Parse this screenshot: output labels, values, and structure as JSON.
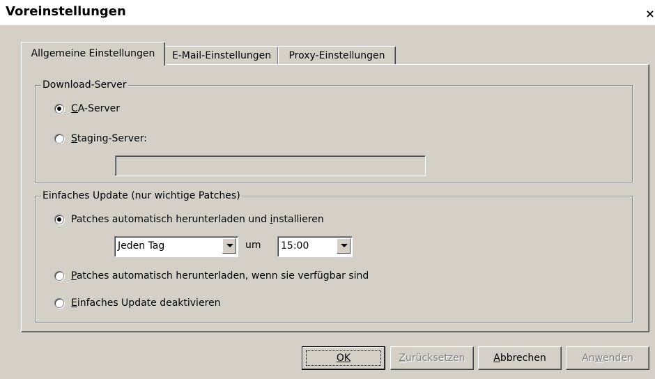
{
  "window": {
    "title": "Voreinstellungen",
    "close_label": "×"
  },
  "tabs": [
    {
      "label": "Allgemeine Einstellungen",
      "active": true
    },
    {
      "label": "E-Mail-Einstellungen",
      "active": false
    },
    {
      "label": "Proxy-Einstellungen",
      "active": false
    }
  ],
  "download_server": {
    "legend": "Download-Server",
    "options": [
      {
        "label_mnemonic": "C",
        "label_rest": "A-Server",
        "selected": true
      },
      {
        "label_mnemonic": "S",
        "label_rest": "taging-Server:",
        "selected": false
      }
    ],
    "staging_value": ""
  },
  "update": {
    "legend": "Einfaches Update (nur wichtige Patches)",
    "option1_before": "Patches automatisch herunterladen und ",
    "option1_mnemonic": "i",
    "option1_after": "nstallieren",
    "option2_mnemonic": "P",
    "option2_rest": "atches automatisch herunterladen, wenn sie verfügbar sind",
    "option3_mnemonic": "E",
    "option3_rest": "infaches Update deaktivieren",
    "selected_option": 1,
    "frequency": "Jeden Tag",
    "um_label": "um",
    "time": "15:00"
  },
  "buttons": {
    "ok": "OK",
    "reset_mnemonic": "Z",
    "reset_rest": "urücksetzen",
    "cancel_mnemonic": "A",
    "cancel_rest": "bbrechen",
    "apply_before": "An",
    "apply_mnemonic": "w",
    "apply_after": "enden"
  },
  "colors": {
    "dialog_bg": "#d4d0c8",
    "disabled_text": "#808080"
  }
}
